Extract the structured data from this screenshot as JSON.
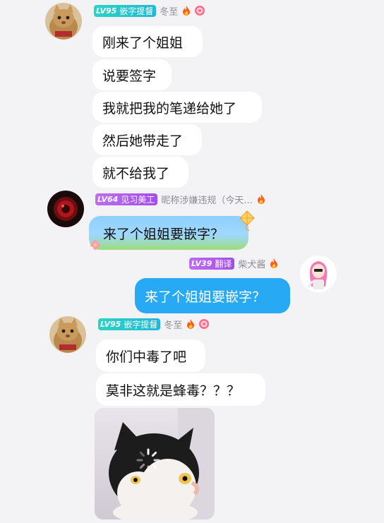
{
  "messages": [
    {
      "level": "LV95",
      "title": "嵌字提督",
      "nick": "冬至",
      "lines": [
        "刚来了个姐姐",
        "说要签字",
        "我就把我的笔递给她了",
        "然后她带走了",
        "就不给我了"
      ]
    },
    {
      "level": "LV64",
      "title": "见习美工",
      "nick": "昵称涉嫌违规（今天...",
      "lines": [
        "来了个姐姐要嵌字？"
      ]
    },
    {
      "level": "LV39",
      "title": "翻译",
      "nick": "柴犬酱",
      "lines": [
        "来了个姐姐要嵌字？"
      ]
    },
    {
      "level": "LV95",
      "title": "嵌字提督",
      "nick": "冬至",
      "lines": [
        "你们中毒了吧",
        "莫非这就是蜂毒？？？"
      ]
    }
  ],
  "icons": {
    "fire": "fire-icon",
    "medal": "medal-icon",
    "loading": "loading-spinner-icon",
    "kite": "kite-sticker-icon"
  },
  "colors": {
    "teal_badge": "#29d4c4",
    "purple_badge": "#b25cee",
    "blue_bubble": "#27a9f3",
    "background": "#f3f3f6"
  }
}
